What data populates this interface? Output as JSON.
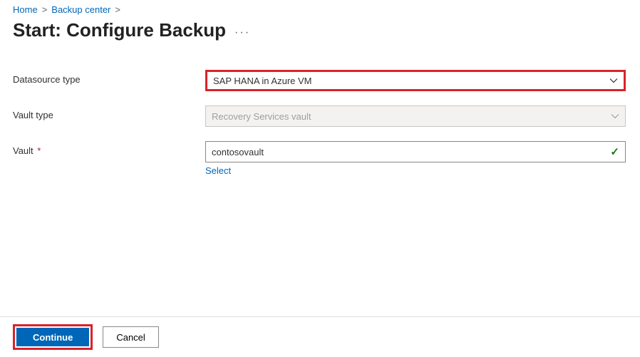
{
  "breadcrumb": {
    "home": "Home",
    "backup_center": "Backup center"
  },
  "page": {
    "title": "Start: Configure Backup"
  },
  "form": {
    "datasource_type": {
      "label": "Datasource type",
      "value": "SAP HANA in Azure VM"
    },
    "vault_type": {
      "label": "Vault type",
      "value": "Recovery Services vault"
    },
    "vault": {
      "label": "Vault",
      "required_mark": "*",
      "value": "contosovault",
      "select_link": "Select"
    }
  },
  "footer": {
    "continue": "Continue",
    "cancel": "Cancel"
  }
}
